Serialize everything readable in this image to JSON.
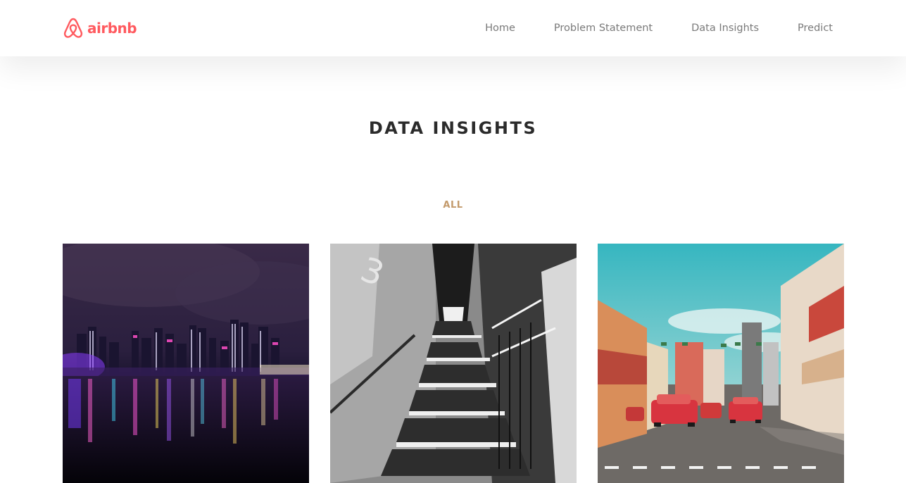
{
  "brand": {
    "name": "airbnb",
    "color": "#ff5a5f",
    "icon": "airbnb-logo-icon"
  },
  "nav": {
    "items": [
      {
        "label": "Home"
      },
      {
        "label": "Problem Statement"
      },
      {
        "label": "Data Insights"
      },
      {
        "label": "Predict"
      }
    ]
  },
  "main": {
    "title": "DATA INSIGHTS",
    "filter": {
      "label": "ALL",
      "color": "#c39a6b"
    },
    "gallery": [
      {
        "image": "singapore-night-skyline-photo"
      },
      {
        "image": "black-and-white-staircase-photo"
      },
      {
        "image": "chinatown-street-taxis-photo"
      }
    ]
  }
}
